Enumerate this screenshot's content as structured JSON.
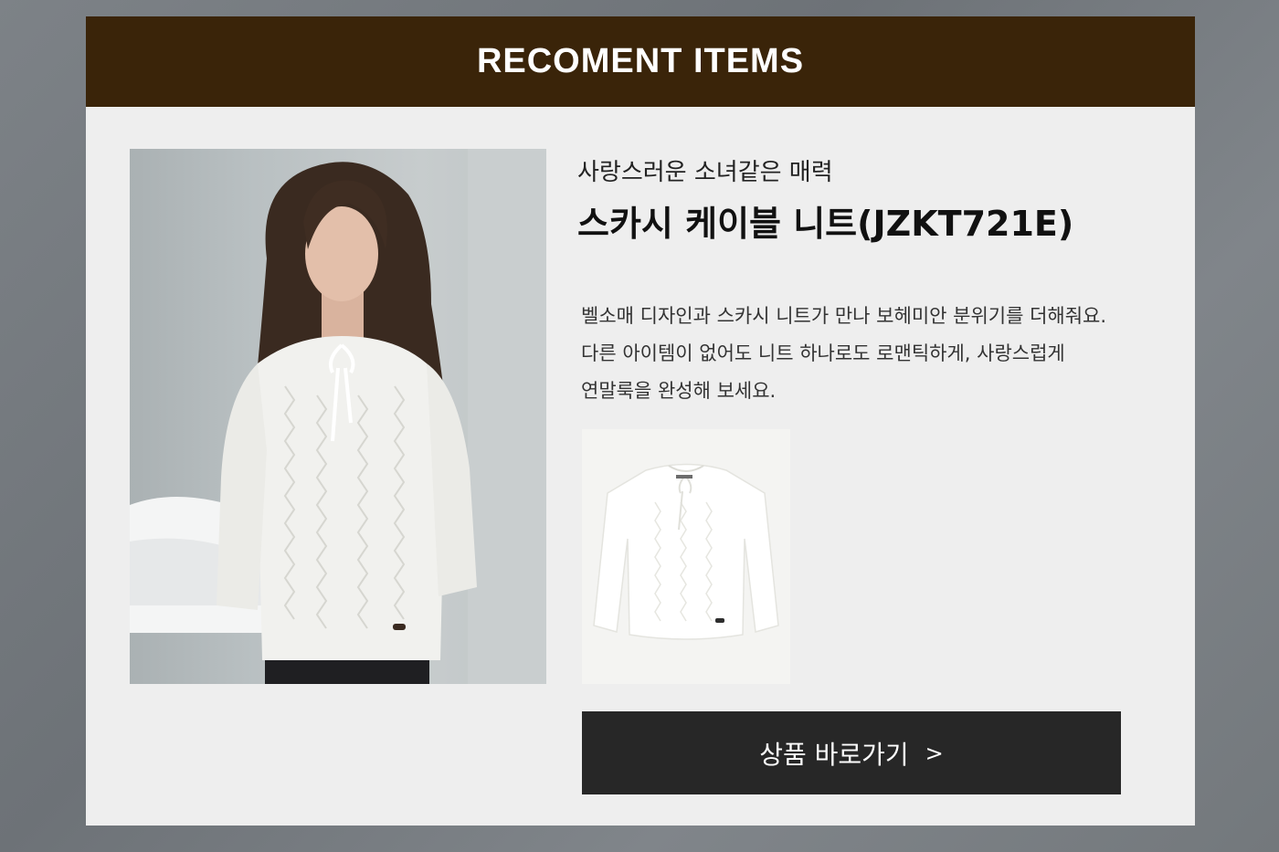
{
  "header": {
    "title": "RECOMENT ITEMS"
  },
  "product": {
    "subtitle": "사랑스러운 소녀같은 매력",
    "name": "스카시 케이블 니트(JZKT721E)",
    "description": [
      "벨소매 디자인과 스카시 니트가 만나 보헤미안 분위기를 더해줘요.",
      "다른 아이템이 없어도 니트 하나로도 로맨틱하게, 사랑스럽게",
      "연말룩을 완성해 보세요."
    ]
  },
  "cta": {
    "label": "상품 바로가기",
    "arrow": ">"
  },
  "colors": {
    "header_bg": "#3a2409",
    "button_bg": "#272727",
    "panel_bg": "#eeeeee"
  }
}
